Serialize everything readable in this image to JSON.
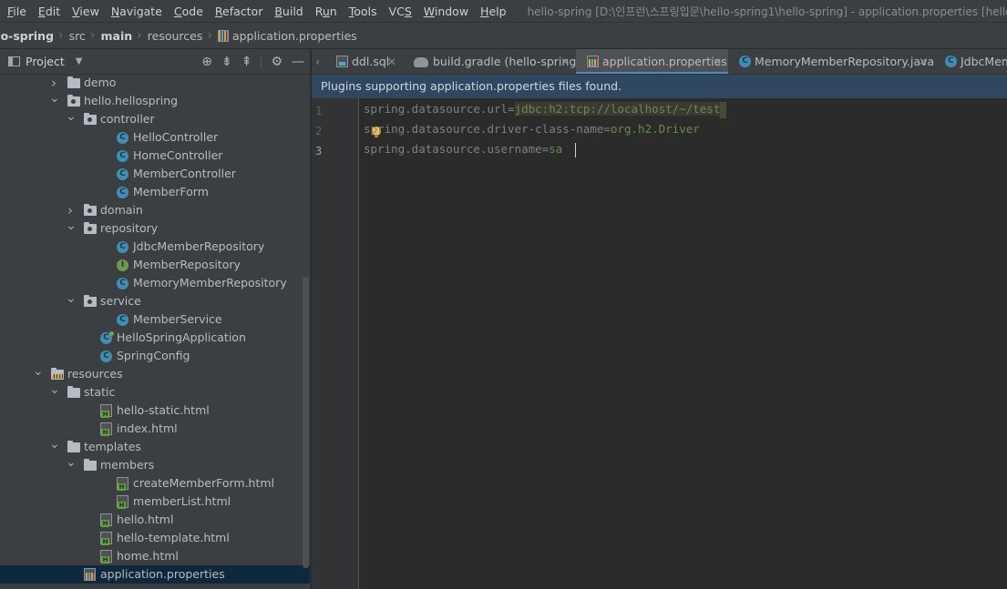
{
  "menu": [
    {
      "label": "File",
      "u": "F"
    },
    {
      "label": "Edit",
      "u": "E"
    },
    {
      "label": "View",
      "u": "V"
    },
    {
      "label": "Navigate",
      "u": "N"
    },
    {
      "label": "Code",
      "u": "C"
    },
    {
      "label": "Refactor",
      "u": "R"
    },
    {
      "label": "Build",
      "u": "B"
    },
    {
      "label": "Run",
      "u": "u"
    },
    {
      "label": "Tools",
      "u": "T"
    },
    {
      "label": "VCS",
      "u": "S"
    },
    {
      "label": "Window",
      "u": "W"
    },
    {
      "label": "Help",
      "u": "H"
    }
  ],
  "window_title": "hello-spring [D:\\인프런\\스프링입문\\hello-spring1\\hello-spring] - application.properties [hello-spring.main]",
  "breadcrumb": [
    "llo-spring",
    "src",
    "main",
    "resources",
    "application.properties"
  ],
  "project_panel": {
    "title": "Project"
  },
  "tree": [
    {
      "label": "demo",
      "icon": "folder",
      "arrow": "right",
      "depth": 4
    },
    {
      "label": "hello.hellospring",
      "icon": "pkg",
      "arrow": "down",
      "depth": 4
    },
    {
      "label": "controller",
      "icon": "pkg",
      "arrow": "down",
      "depth": 5
    },
    {
      "label": "HelloController",
      "icon": "class",
      "depth": 7
    },
    {
      "label": "HomeController",
      "icon": "class",
      "depth": 7
    },
    {
      "label": "MemberController",
      "icon": "class",
      "depth": 7
    },
    {
      "label": "MemberForm",
      "icon": "class",
      "depth": 7
    },
    {
      "label": "domain",
      "icon": "pkg",
      "arrow": "right",
      "depth": 5
    },
    {
      "label": "repository",
      "icon": "pkg",
      "arrow": "down",
      "depth": 5
    },
    {
      "label": "JdbcMemberRepository",
      "icon": "class",
      "depth": 7
    },
    {
      "label": "MemberRepository",
      "icon": "interface",
      "depth": 7
    },
    {
      "label": "MemoryMemberRepository",
      "icon": "class",
      "depth": 7
    },
    {
      "label": "service",
      "icon": "pkg",
      "arrow": "down",
      "depth": 5
    },
    {
      "label": "MemberService",
      "icon": "class",
      "depth": 7
    },
    {
      "label": "HelloSpringApplication",
      "icon": "spring",
      "depth": 6
    },
    {
      "label": "SpringConfig",
      "icon": "class",
      "depth": 6
    },
    {
      "label": "resources",
      "icon": "res",
      "arrow": "down",
      "depth": 3
    },
    {
      "label": "static",
      "icon": "folder",
      "arrow": "down",
      "depth": 4
    },
    {
      "label": "hello-static.html",
      "icon": "html",
      "depth": 6
    },
    {
      "label": "index.html",
      "icon": "html",
      "depth": 6
    },
    {
      "label": "templates",
      "icon": "folder",
      "arrow": "down",
      "depth": 4
    },
    {
      "label": "members",
      "icon": "folder",
      "arrow": "down",
      "depth": 5
    },
    {
      "label": "createMemberForm.html",
      "icon": "html",
      "depth": 7
    },
    {
      "label": "memberList.html",
      "icon": "html",
      "depth": 7
    },
    {
      "label": "hello.html",
      "icon": "html",
      "depth": 6
    },
    {
      "label": "hello-template.html",
      "icon": "html",
      "depth": 6
    },
    {
      "label": "home.html",
      "icon": "html",
      "depth": 6
    },
    {
      "label": "application.properties",
      "icon": "props",
      "depth": 5,
      "selected": true
    }
  ],
  "tabs": [
    {
      "label": "ddl.sql",
      "icon": "sql",
      "closable": true
    },
    {
      "label": "build.gradle (hello-spring)",
      "icon": "gradle",
      "closable": true
    },
    {
      "label": "application.properties",
      "icon": "props",
      "closable": true,
      "active": true
    },
    {
      "label": "MemoryMemberRepository.java",
      "icon": "class",
      "closable": true
    },
    {
      "label": "JdbcMemberRepository.java",
      "icon": "class",
      "closable": false
    }
  ],
  "banner": "Plugins supporting application.properties files found.",
  "editor": {
    "line_numbers": [
      "1",
      "2",
      "3"
    ],
    "lines": [
      {
        "key": "spring.datasource.url",
        "eq": "=",
        "value": "jdbc:h2:tcp://localhost/~/test"
      },
      {
        "key": "spring.datasource.driver-class-name",
        "eq": "=",
        "value": "org.h2.Driver"
      },
      {
        "key": "spring.datasource.username",
        "eq": "=",
        "value": "sa"
      }
    ]
  },
  "colors": {
    "selection": "#0d293e",
    "accent": "#4a88c7",
    "banner": "#2f4860",
    "string": "#6a8759"
  }
}
